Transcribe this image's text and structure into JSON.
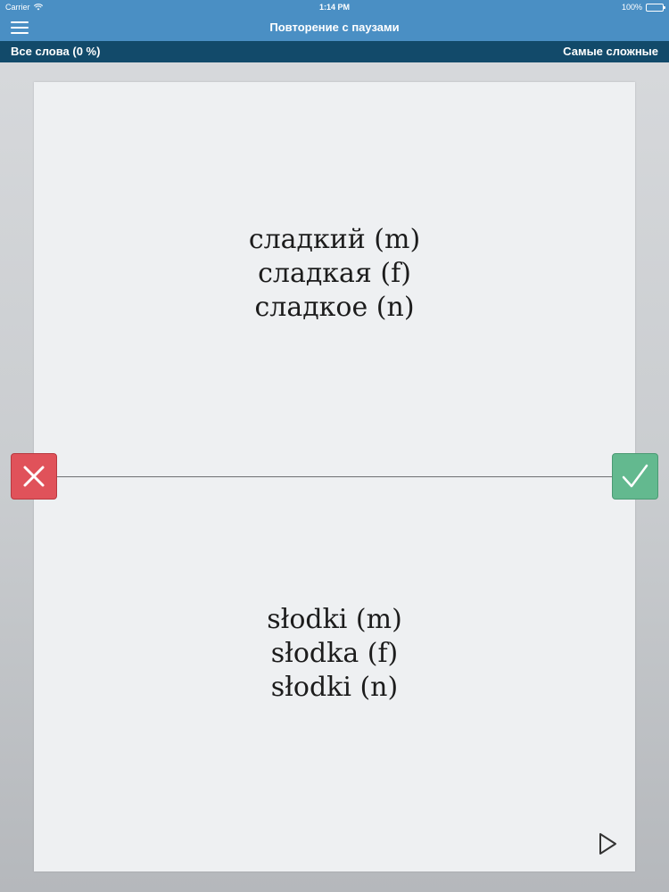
{
  "status_bar": {
    "carrier": "Carrier",
    "time": "1:14 PM",
    "battery": "100%"
  },
  "nav": {
    "title": "Повторение с паузами"
  },
  "sub_bar": {
    "left_label": "Все слова (0 %)",
    "right_label": "Самые сложные"
  },
  "card": {
    "front": [
      "сладкий (m)",
      "сладкая (f)",
      "сладкое (n)"
    ],
    "back": [
      "słodki (m)",
      "słodka (f)",
      "słodki (n)"
    ]
  },
  "colors": {
    "nav_blue": "#4a8fc4",
    "sub_bar_navy": "#124a6a",
    "wrong_red": "#e0525a",
    "correct_green": "#63b98f"
  },
  "icons": {
    "menu": "menu-icon",
    "wrong": "close-icon",
    "correct": "checkmark-icon",
    "play": "play-icon"
  }
}
